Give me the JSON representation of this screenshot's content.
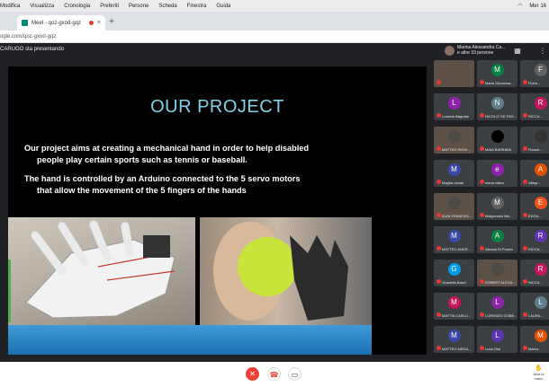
{
  "menubar": {
    "items": [
      "Modifica",
      "Visualizza",
      "Cronologia",
      "Preferiti",
      "Persone",
      "Scheda",
      "Finestra",
      "Guida"
    ],
    "clock": "Mer 16"
  },
  "browser": {
    "tab_title": "Meet - qoz-gxod-gqz",
    "url": "ogle.com/qoz-gxod-gqz"
  },
  "meet": {
    "presenting_text": "CARUGO sta presentando",
    "people_line1": "Marina Alessandra Ca...",
    "people_line2": "e altre 33 persone",
    "controls": {
      "raise_hand_label": "Alza la mano"
    }
  },
  "slide": {
    "title": "OUR PROJECT",
    "paragraph1_line1": "Our project aims at creating a mechanical hand in order to help disabled",
    "paragraph1_line2": "people  play certain sports such as tennis or baseball.",
    "paragraph2_line1": "The hand is controlled by an Arduino connected to the 5 servo motors",
    "paragraph2_line2": "that allow the movement of the 5 fingers of the hands"
  },
  "participants": [
    {
      "initial": "",
      "name": "",
      "color": "#5d5147",
      "cam": true
    },
    {
      "initial": "M",
      "name": "Maria Giovanna...",
      "color": "#0b8043",
      "cam": false
    },
    {
      "initial": "F",
      "name": "Fiorin...",
      "color": "#616161",
      "cam": false
    },
    {
      "initial": "L",
      "name": "Luciano Bagnato",
      "color": "#8e24aa",
      "cam": false
    },
    {
      "initial": "N",
      "name": "NICOLO' DE PAS...",
      "color": "#607d8b",
      "cam": false
    },
    {
      "initial": "R",
      "name": "RICCA...",
      "color": "#c2185b",
      "cam": false
    },
    {
      "initial": "",
      "name": "MATTEO RICHI...",
      "color": "#4e4a46",
      "cam": true
    },
    {
      "initial": "",
      "name": "MAIA BARBIANI",
      "color": "#000000",
      "cam": false
    },
    {
      "initial": "",
      "name": "Rossel...",
      "color": "#333333",
      "cam": false
    },
    {
      "initial": "M",
      "name": "Magda Janak",
      "color": "#3949ab",
      "cam": false
    },
    {
      "initial": "e",
      "name": "elena vitara",
      "color": "#8e24aa",
      "cam": false
    },
    {
      "initial": "A",
      "name": "Allegr...",
      "color": "#e65100",
      "cam": false
    },
    {
      "initial": "",
      "name": "IDAN FRANCES...",
      "color": "#4e4a46",
      "cam": true
    },
    {
      "initial": "M",
      "name": "Malgorzata Nei...",
      "color": "#616161",
      "cam": false
    },
    {
      "initial": "E",
      "name": "EDOA...",
      "color": "#f4511e",
      "cam": false
    },
    {
      "initial": "M",
      "name": "MATTEO ANDR...",
      "color": "#3949ab",
      "cam": false
    },
    {
      "initial": "A",
      "name": "Alessia Di Puorto",
      "color": "#0b8043",
      "cam": false
    },
    {
      "initial": "R",
      "name": "RICCA...",
      "color": "#5e35b1",
      "cam": false
    },
    {
      "initial": "G",
      "name": "Graziella Bozzi",
      "color": "#039be5",
      "cam": false
    },
    {
      "initial": "",
      "name": "ROBERT ALEXA...",
      "color": "#4e4a46",
      "cam": true
    },
    {
      "initial": "R",
      "name": "RICCA...",
      "color": "#c2185b",
      "cam": false
    },
    {
      "initial": "M",
      "name": "MATTIA CARLU...",
      "color": "#c2185b",
      "cam": false
    },
    {
      "initial": "L",
      "name": "LORENZO GOBB...",
      "color": "#8e24aa",
      "cam": false
    },
    {
      "initial": "L",
      "name": "LAURA...",
      "color": "#607d8b",
      "cam": false
    },
    {
      "initial": "M",
      "name": "MATTEO MEDA...",
      "color": "#3949ab",
      "cam": false
    },
    {
      "initial": "L",
      "name": "Luca Orsi",
      "color": "#5e35b1",
      "cam": false
    },
    {
      "initial": "M",
      "name": "Marco...",
      "color": "#e65100",
      "cam": false
    }
  ]
}
